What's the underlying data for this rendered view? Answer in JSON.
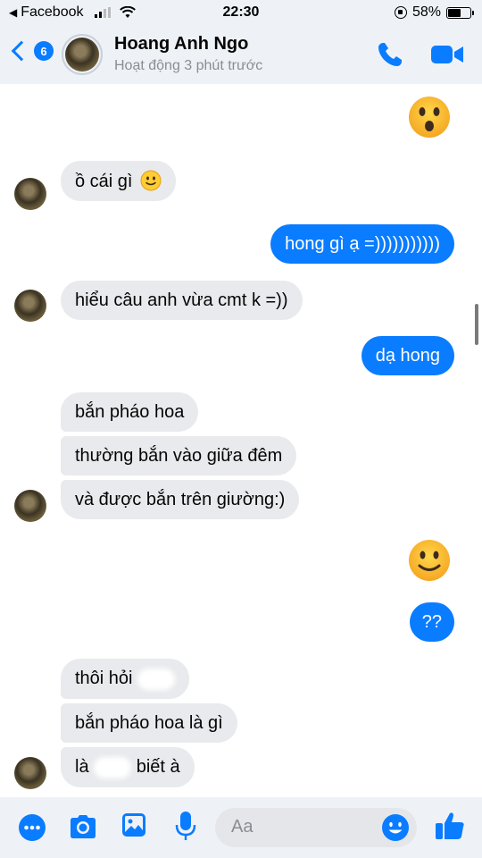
{
  "status_bar": {
    "back_app": "Facebook",
    "time": "22:30",
    "battery": "58%",
    "battery_level": 0.58
  },
  "header": {
    "back_count": "6",
    "name": "Hoang Anh Ngo",
    "status": "Hoạt động 3 phút trước"
  },
  "messages": [
    {
      "id": 0,
      "from": "me",
      "type": "emoji",
      "icon": "surprised-face-emoji"
    },
    {
      "id": 1,
      "from": "them",
      "text": "ồ cái gì",
      "icon": "slight-smile-emoji"
    },
    {
      "id": 2,
      "from": "me",
      "text": "hong gì ạ =)))))))))))"
    },
    {
      "id": 3,
      "from": "them",
      "text": "hiểu câu anh vừa cmt k =))"
    },
    {
      "id": 4,
      "from": "me",
      "text": "dạ hong"
    },
    {
      "id": 5,
      "from": "them",
      "text": "bắn pháo hoa"
    },
    {
      "id": 6,
      "from": "them",
      "text": "thường bắn vào giữa đêm"
    },
    {
      "id": 7,
      "from": "them",
      "text": "và được bắn trên giường:)"
    },
    {
      "id": 8,
      "from": "me",
      "type": "emoji",
      "icon": "slight-smile-emoji"
    },
    {
      "id": 9,
      "from": "me",
      "text": "??"
    },
    {
      "id": 10,
      "from": "them",
      "text": "thôi hỏi"
    },
    {
      "id": 11,
      "from": "them",
      "text": "bắn pháo hoa là gì"
    },
    {
      "id": 12,
      "from": "them",
      "text_before": "là",
      "text_after": "biết à"
    }
  ],
  "composer": {
    "placeholder": "Aa"
  },
  "colors": {
    "accent": "#0a7cff",
    "incoming_bubble": "#e9eaed",
    "header_bg": "#eef2f7"
  }
}
